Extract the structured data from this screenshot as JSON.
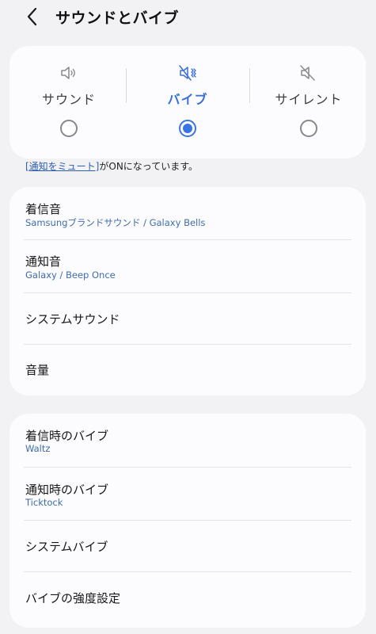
{
  "header": {
    "title": "サウンドとバイブ"
  },
  "modes": [
    {
      "label": "サウンド",
      "icon": "speaker-icon",
      "selected": false
    },
    {
      "label": "バイブ",
      "icon": "vibrate-icon",
      "selected": true
    },
    {
      "label": "サイレント",
      "icon": "mute-icon",
      "selected": false
    }
  ],
  "notice": {
    "link_text": "[通知をミュート]",
    "rest_text": "がONになっています。"
  },
  "sound_list": [
    {
      "title": "着信音",
      "subtitle": "Samsungブランドサウンド / Galaxy Bells"
    },
    {
      "title": "通知音",
      "subtitle": "Galaxy / Beep Once"
    },
    {
      "title": "システムサウンド"
    },
    {
      "title": "音量"
    }
  ],
  "vibration_list": [
    {
      "title": "着信時のバイブ",
      "subtitle": "Waltz"
    },
    {
      "title": "通知時のバイブ",
      "subtitle": "Ticktock"
    },
    {
      "title": "システムバイブ"
    },
    {
      "title": "バイブの強度設定"
    }
  ],
  "colors": {
    "accent": "#3a74e4",
    "subtitle": "#3e6db0",
    "background": "#f2f2f4",
    "card": "#fcfcfe"
  }
}
